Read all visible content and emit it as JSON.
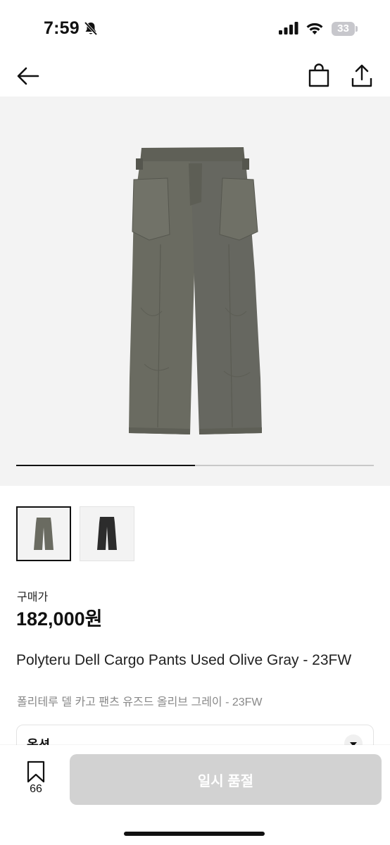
{
  "status_bar": {
    "time": "7:59",
    "battery": "33"
  },
  "nav": {
    "back_icon": "arrow-left-icon",
    "bag_icon": "shopping-bag-icon",
    "share_icon": "share-icon"
  },
  "gallery": {
    "images": [
      "olive-gray-cargo-pants",
      "black-cargo-pants"
    ],
    "selected_index": 0,
    "progress": 0.5
  },
  "price": {
    "label": "구매가",
    "value": "182,000원"
  },
  "product": {
    "title_en": "Polyteru Dell Cargo Pants Used Olive Gray - 23FW",
    "title_ko": "폴리테루 델 카고 팬츠 유즈드 올리브 그레이 - 23FW"
  },
  "option": {
    "label": "옵션"
  },
  "bottom_bar": {
    "bookmark_count": "66",
    "button_label": "일시 품절"
  },
  "colors": {
    "button_disabled": "#d2d2d2",
    "pants_olive": "#68695f",
    "pants_black": "#2c2c2c"
  }
}
